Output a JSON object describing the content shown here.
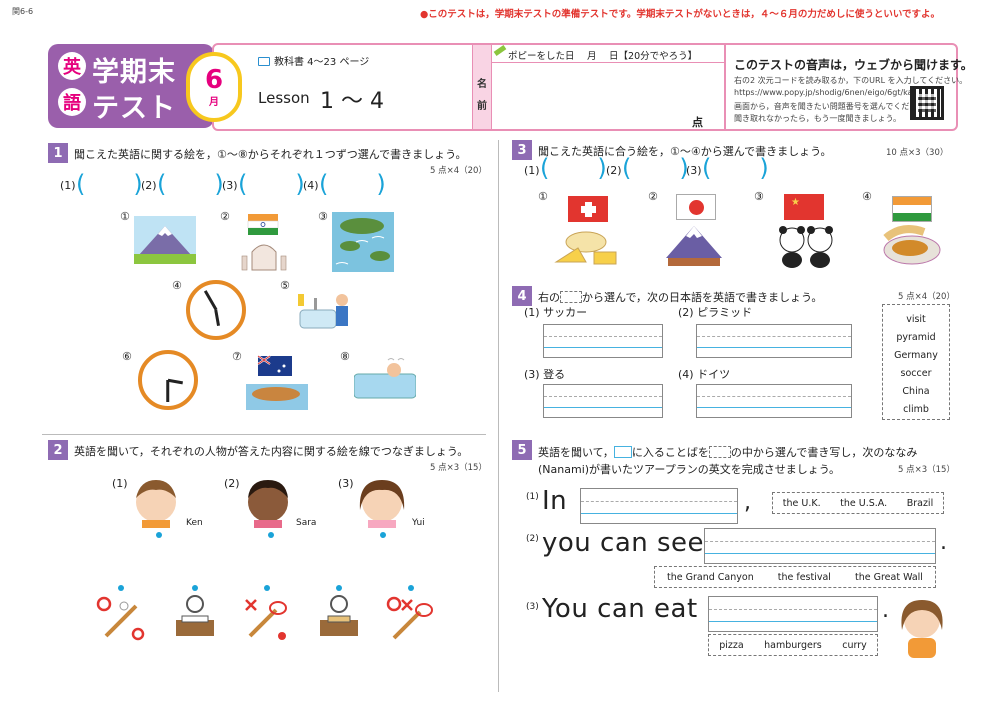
{
  "header": {
    "code": "関6-6",
    "notice": "●このテストは，学期末テストの準備テストです。学期末テストがないときは，４～６月の力だめしに使うといいですよ。",
    "eigo_1": "英",
    "eigo_2": "語",
    "title_1": "学期末",
    "title_2": "テスト",
    "month": "6",
    "month_unit": "月",
    "textbook": "教科書 4〜23 ページ",
    "lesson_label": "Lesson",
    "lesson_range": "1 〜 4",
    "name_c1": "名",
    "name_c2": "前",
    "popy_date": "ポピーをした日　 月　 日【20分でやろう】",
    "score_unit": "点",
    "web_title": "このテストの音声は，ウェブから聞けます。",
    "web_line1": "右の2 次元コードを読み取るか，下のURL を入力してください。",
    "web_url": "https://www.popy.jp/shodig/6nen/eigo/6gt/kai/gtest/",
    "web_line2": "画面から，音声を聞きたい問題番号を選んでください。",
    "web_line3": "聞き取れなかったら，もう一度聞きましょう。"
  },
  "q1": {
    "num": "1",
    "text": "聞こえた英語に関する絵を，①〜⑧からそれぞれ１つずつ選んで書きましょう。",
    "points": "5 点×4（20）",
    "blanks": [
      "(1)",
      "(2)",
      "(3)",
      "(4)"
    ],
    "pictures": [
      "①",
      "②",
      "③",
      "④",
      "⑤",
      "⑥",
      "⑦",
      "⑧"
    ]
  },
  "q2": {
    "num": "2",
    "text": "英語を聞いて，それぞれの人物が答えた内容に関する絵を線でつなぎましょう。",
    "points": "5 点×3（15）",
    "people": [
      {
        "no": "(1)",
        "name": "Ken"
      },
      {
        "no": "(2)",
        "name": "Sara"
      },
      {
        "no": "(3)",
        "name": "Yui"
      }
    ]
  },
  "q3": {
    "num": "3",
    "text": "聞こえた英語に合う絵を，①〜④から選んで書きましょう。",
    "points": "10 点×3（30）",
    "blanks": [
      "(1)",
      "(2)",
      "(3)"
    ],
    "pictures": [
      "①",
      "②",
      "③",
      "④"
    ]
  },
  "q4": {
    "num": "4",
    "text_a": "右の",
    "text_b": "から選んで，次の日本語を英語で書きましょう。",
    "points": "5 点×4（20）",
    "items": [
      {
        "no": "(1)",
        "label": "サッカー"
      },
      {
        "no": "(2)",
        "label": "ピラミッド"
      },
      {
        "no": "(3)",
        "label": "登る"
      },
      {
        "no": "(4)",
        "label": "ドイツ"
      }
    ],
    "words": [
      "visit",
      "pyramid",
      "Germany",
      "soccer",
      "China",
      "climb"
    ]
  },
  "q5": {
    "num": "5",
    "text_a": "英語を聞いて，",
    "text_b": "に入ることばを",
    "text_c": "の中から選んで書き写し，次のななみ",
    "text_d": "(Nanami)が書いたツアープランの英文を完成させましょう。",
    "points": "5 点×3（15）",
    "lines": [
      {
        "no": "(1)",
        "text": "In",
        "end": ",",
        "choices": [
          "the U.K.",
          "the U.S.A.",
          "Brazil"
        ]
      },
      {
        "no": "(2)",
        "text": "you can see",
        "end": ".",
        "choices": [
          "the Grand Canyon",
          "the festival",
          "the Great Wall"
        ]
      },
      {
        "no": "(3)",
        "text": "You can eat",
        "end": ".",
        "choices": [
          "pizza",
          "hamburgers",
          "curry"
        ]
      }
    ]
  }
}
